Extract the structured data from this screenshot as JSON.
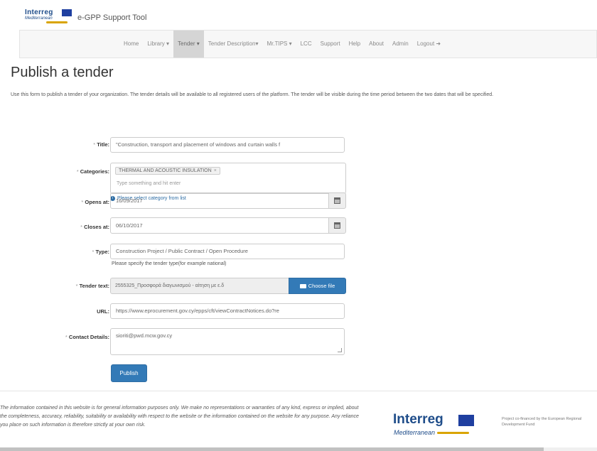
{
  "brand": {
    "logo_word": "Interreg",
    "logo_sub": "Mediterranean",
    "title": "e-GPP Support Tool"
  },
  "nav": {
    "items": [
      {
        "label": "Home"
      },
      {
        "label": "Library ▾"
      },
      {
        "label": "Tender ▾",
        "active": true
      },
      {
        "label": "Tender Description▾"
      },
      {
        "label": "Mr.TIPS ▾"
      },
      {
        "label": "LCC"
      },
      {
        "label": "Support"
      },
      {
        "label": "Help"
      },
      {
        "label": "About"
      },
      {
        "label": "Admin"
      },
      {
        "label": "Logout ➜"
      }
    ]
  },
  "page": {
    "title": "Publish a tender",
    "intro": "Use this form to publish a tender of your organization. The tender details will be available to all registered users of the platform. The tender will be visible during the time period between the two dates that will be specified."
  },
  "form": {
    "title": {
      "label": "Title:",
      "value": "\"Construction, transport and placement of windows and curtain walls f"
    },
    "categories": {
      "label": "Categories:",
      "tag": "THERMAL AND ACOUSTIC INSULATION",
      "tag_remove": "×",
      "placeholder": "Type something and hit enter",
      "hint": "Please select category from list"
    },
    "opens_at": {
      "label": "Opens at:",
      "value": "16/09/2017"
    },
    "closes_at": {
      "label": "Closes at:",
      "value": "06/10/2017"
    },
    "type": {
      "label": "Type:",
      "value": "Construction Project / Public Contract / Open Procedure",
      "help": "Please specify the tender type(for example national)"
    },
    "tender_text": {
      "label": "Tender text:",
      "value": "2555325_Προσφορά διαγωνισμού - αίτηση με ε.δ",
      "button": "Choose file"
    },
    "url": {
      "label": "URL:",
      "value": "https://www.eprocurement.gov.cy/epps/cft/viewContractNotices.do?re"
    },
    "contact": {
      "label": "Contact Details:",
      "value": "sioriti@pwd.mcw.gov.cy"
    },
    "publish": "Publish"
  },
  "footer": {
    "disclaimer": "The information contained in this website is for general information purposes only. We make no representations or warranties of any kind, express or implied, about the completeness, accuracy, reliability, suitability or availability with respect to the website or the information contained on the website for any purpose. Any reliance you place on such information is therefore strictly at your own risk.",
    "logo_word": "Interreg",
    "logo_sub": "Mediterranean",
    "funding": "Project co-financed by the European Regional Development Fund"
  },
  "colors": {
    "primary": "#337ab7",
    "brand_blue": "#1f4d8a",
    "eu_flag": "#1f3fa0",
    "accent_yellow": "#d9a400"
  },
  "icons": [
    "calendar-icon",
    "info-icon",
    "folder-icon"
  ]
}
